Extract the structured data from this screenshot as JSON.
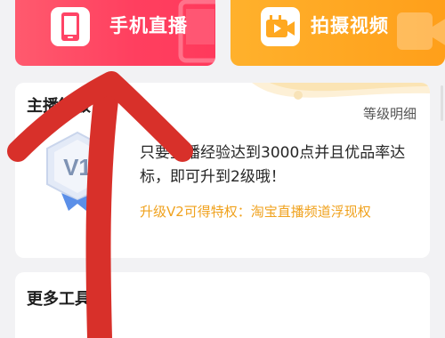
{
  "actions": {
    "live": {
      "label": "手机直播",
      "icon": "phone-icon",
      "color": "#ff4466"
    },
    "video": {
      "label": "拍摄视频",
      "icon": "video-camera-icon",
      "color": "#ffa820"
    }
  },
  "level_card": {
    "title": "主播等级",
    "detail_link": "等级明细",
    "badge_text": "V1",
    "description": "只要主播经验达到3000点并且优品率达标，即可升到2级哦！",
    "privilege": "升级V2可得特权：淘宝直播频道浮现权",
    "accent_color": "#f0a21e"
  },
  "tools_card": {
    "title": "更多工具"
  },
  "annotation": {
    "color": "#d8302a",
    "icon": "up-arrow-annotation"
  }
}
